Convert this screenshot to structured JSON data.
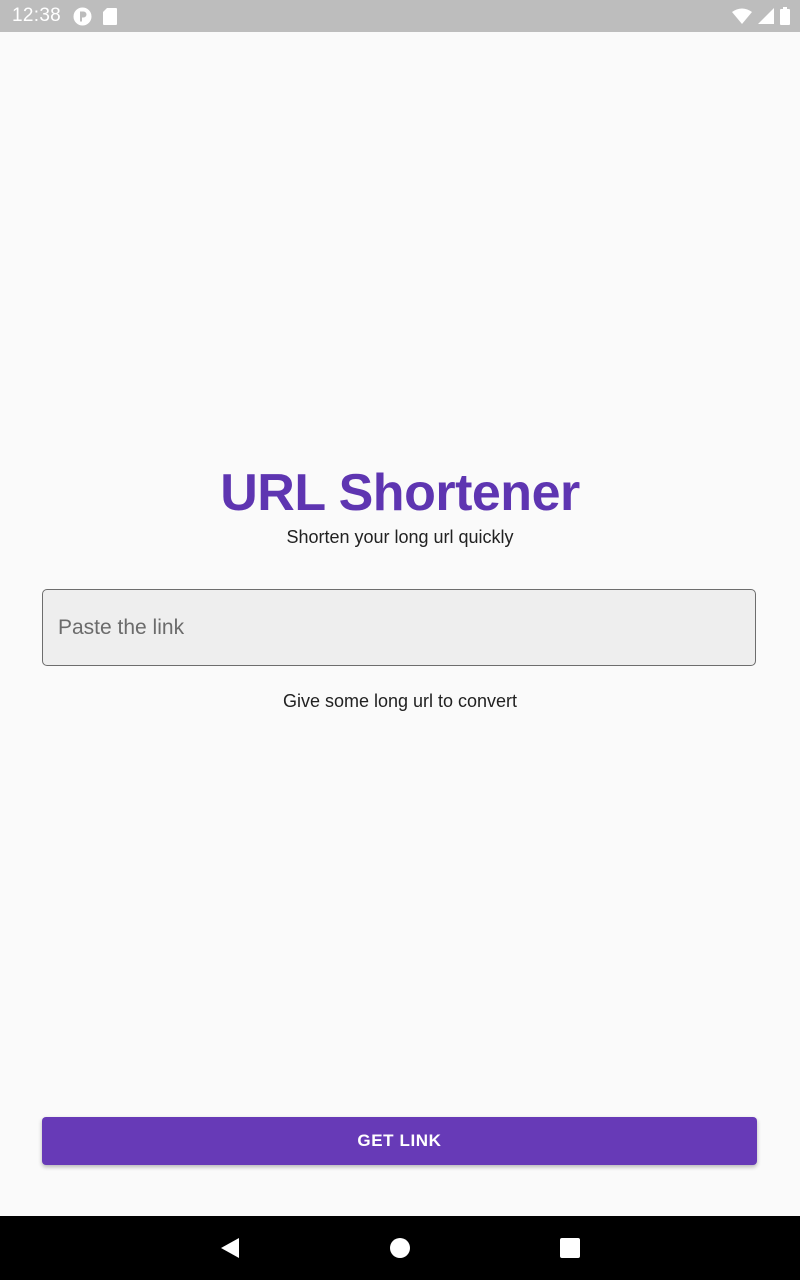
{
  "status_bar": {
    "time": "12:38",
    "left_icons": [
      "notification-app-icon",
      "sd-card-icon"
    ],
    "right_icons": [
      "wifi-icon",
      "cellular-signal-icon",
      "battery-icon"
    ]
  },
  "main": {
    "title": "URL Shortener",
    "subtitle": "Shorten your long url quickly",
    "link_input": {
      "placeholder": "Paste the link",
      "value": ""
    },
    "helper_text": "Give some long url to convert",
    "get_link_button": "GET LINK"
  },
  "colors": {
    "title": "#5e35b1",
    "primary_button": "#673ab7",
    "input_fill": "#eeeeee",
    "background": "#fafafa",
    "status_bar": "#bdbdbd",
    "nav_bar": "#000000"
  },
  "nav_bar": {
    "buttons": [
      "back-icon",
      "home-icon",
      "recents-icon"
    ]
  }
}
